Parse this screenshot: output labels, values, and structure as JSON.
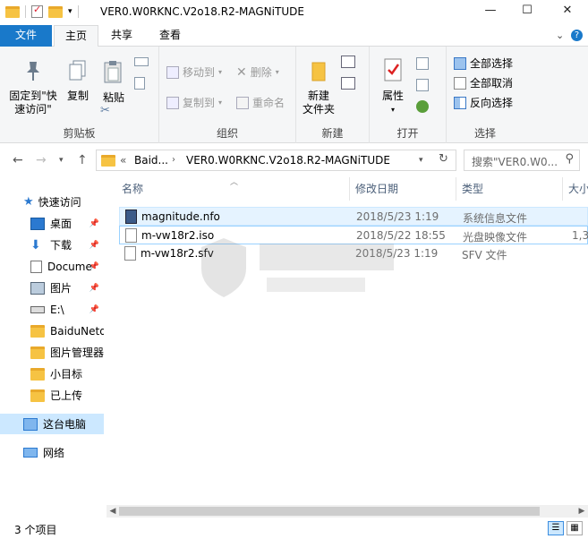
{
  "window": {
    "title": "VER0.W0RKNC.V2o18.R2-MAGNiTUDE",
    "minimize": "—",
    "maximize": "☐",
    "close": "✕"
  },
  "tabs": {
    "file": "文件",
    "home": "主页",
    "share": "共享",
    "view": "查看",
    "collapse": "⌄",
    "help": "?"
  },
  "ribbon": {
    "clipboard": {
      "label": "剪贴板",
      "pin": "固定到\"快速访问\"",
      "copy": "复制",
      "paste": "粘贴"
    },
    "organize": {
      "label": "组织",
      "move_to": "移动到",
      "copy_to": "复制到",
      "delete": "删除",
      "rename": "重命名"
    },
    "new": {
      "label": "新建",
      "new_folder": "新建\n文件夹"
    },
    "open": {
      "label": "打开",
      "properties": "属性"
    },
    "select": {
      "label": "选择",
      "select_all": "全部选择",
      "select_none": "全部取消",
      "invert": "反向选择"
    }
  },
  "address": {
    "crumb_prefix": "«",
    "crumb_1": "Baid...",
    "crumb_2": "VER0.W0RKNC.V2o18.R2-MAGNiTUDE",
    "search_placeholder": "搜索\"VER0.W0..."
  },
  "sidebar": {
    "items": [
      {
        "label": "快速访问"
      },
      {
        "label": "桌面"
      },
      {
        "label": "下载"
      },
      {
        "label": "Docume"
      },
      {
        "label": "图片"
      },
      {
        "label": "E:\\"
      },
      {
        "label": "BaiduNetd"
      },
      {
        "label": "图片管理器"
      },
      {
        "label": "小目标"
      },
      {
        "label": "已上传"
      },
      {
        "label": "这台电脑"
      },
      {
        "label": "网络"
      }
    ]
  },
  "columns": {
    "name": "名称",
    "date": "修改日期",
    "type": "类型",
    "size": "大小"
  },
  "files": [
    {
      "name": "magnitude.nfo",
      "date": "2018/5/23 1:19",
      "type": "系统信息文件",
      "size": ""
    },
    {
      "name": "m-vw18r2.iso",
      "date": "2018/5/22 18:55",
      "type": "光盘映像文件",
      "size": "1,3"
    },
    {
      "name": "m-vw18r2.sfv",
      "date": "2018/5/23 1:19",
      "type": "SFV 文件",
      "size": ""
    }
  ],
  "status": {
    "count": "3 个项目"
  },
  "colors": {
    "accent": "#1979ca",
    "selection": "#cce8ff"
  }
}
